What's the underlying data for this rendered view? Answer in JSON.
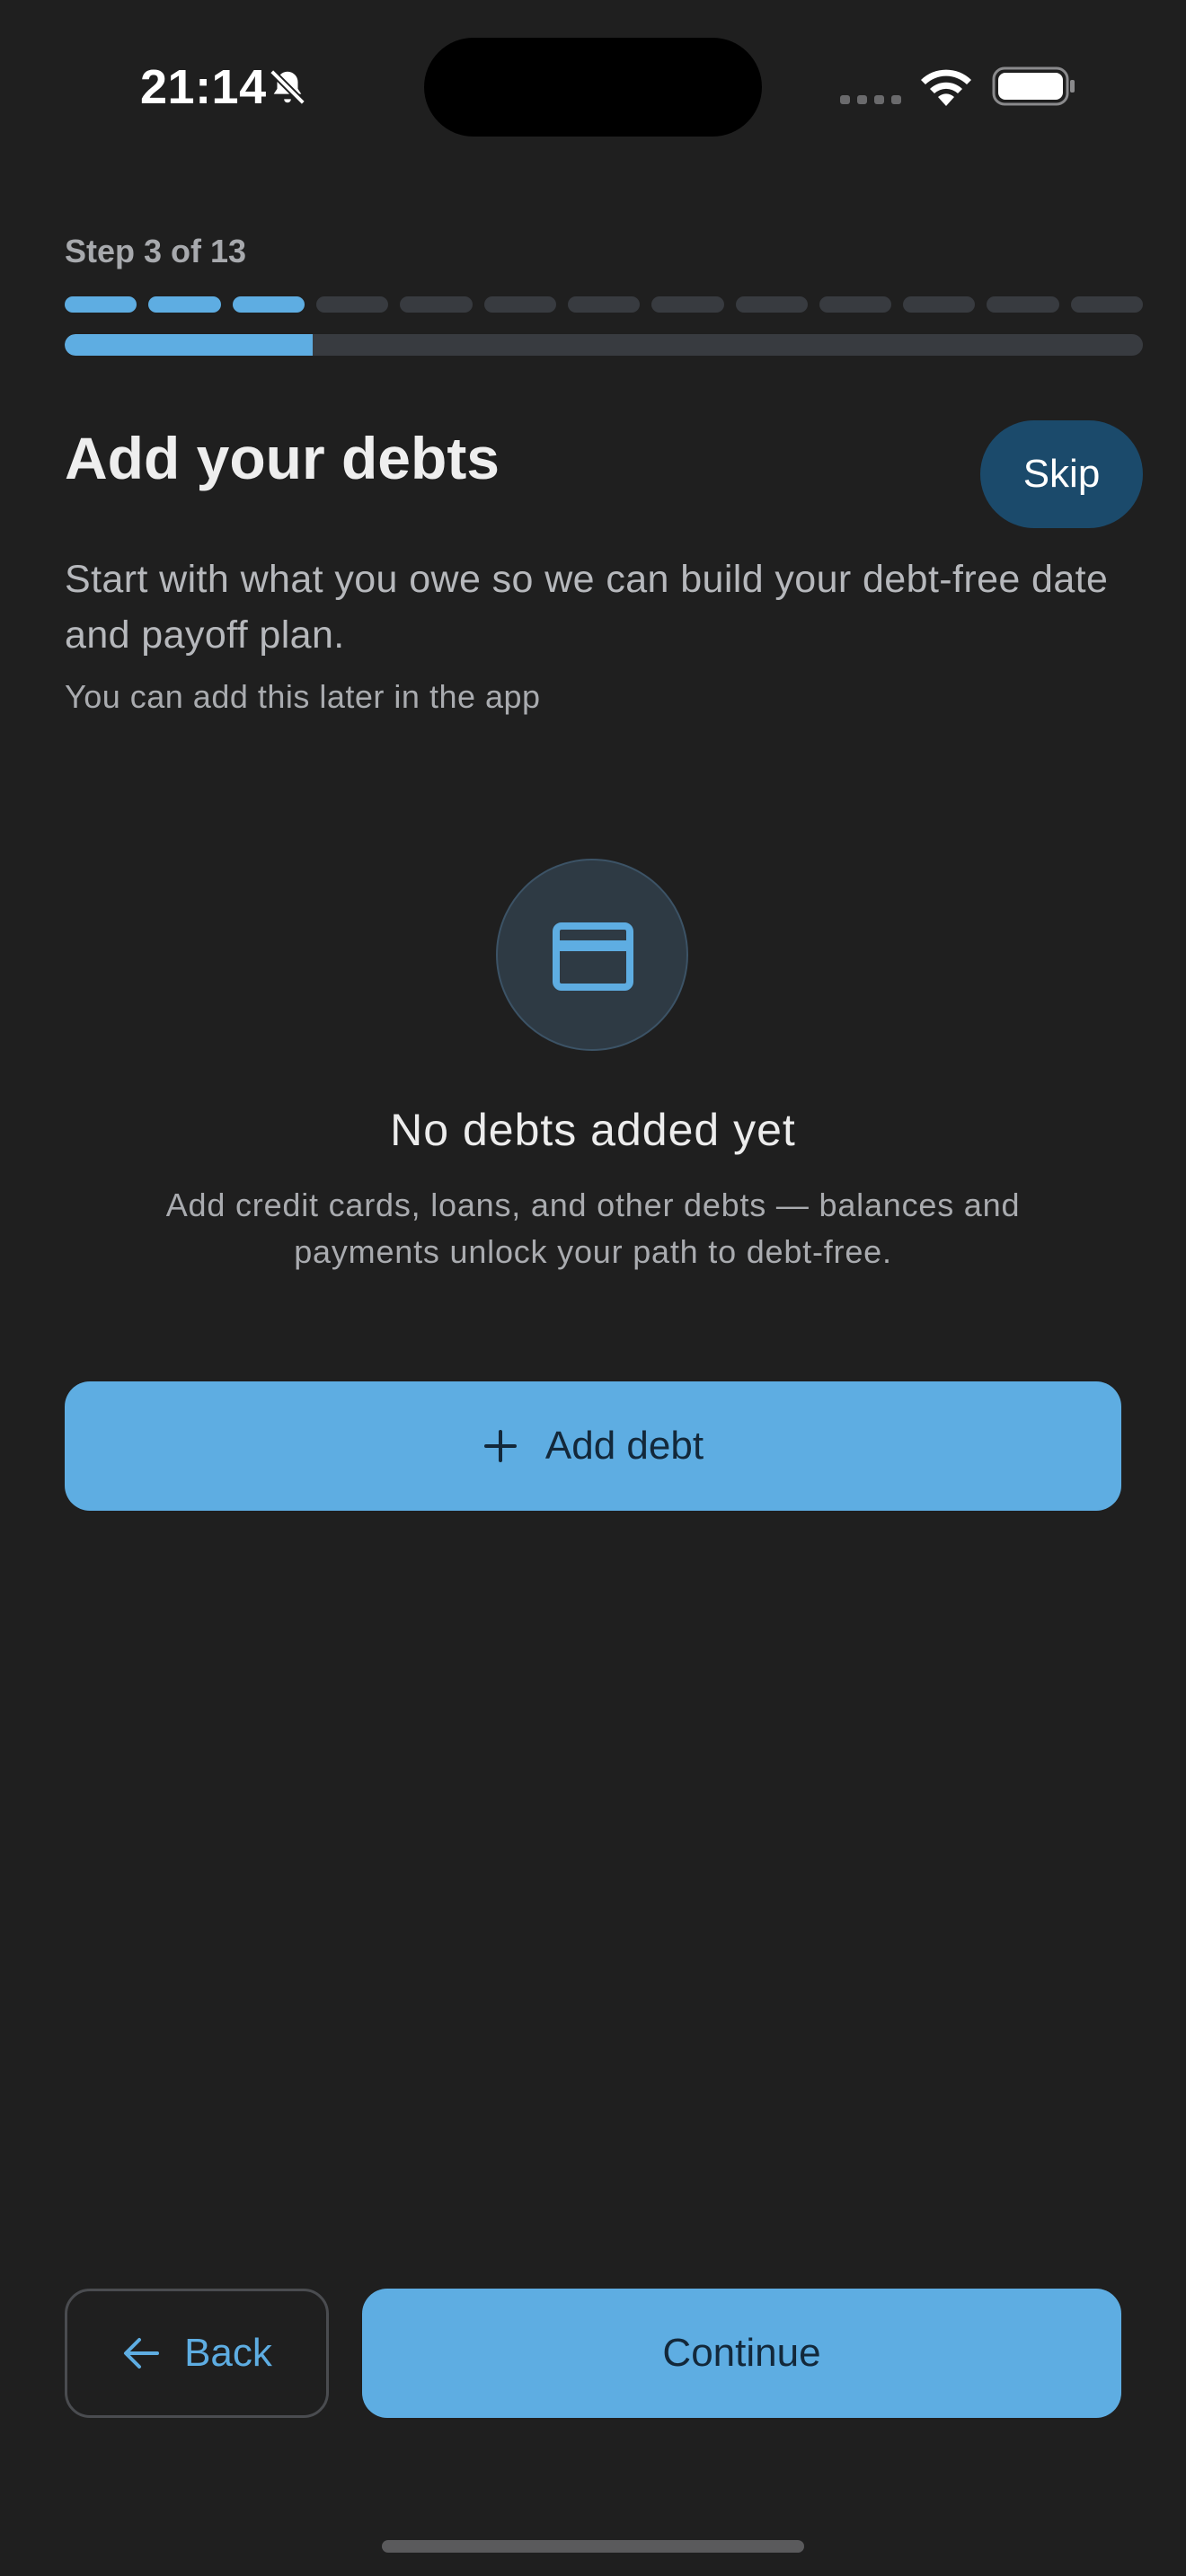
{
  "status_bar": {
    "time": "21:14",
    "icons": [
      "bell-slash-icon",
      "signal-icon",
      "wifi-icon",
      "battery-icon"
    ]
  },
  "progress": {
    "label": "Step 3 of 13",
    "current_step": 3,
    "total_steps": 13,
    "fill_fraction": 0.23
  },
  "header": {
    "title": "Add your debts",
    "skip_label": "Skip"
  },
  "intro": {
    "subtitle": "Start with what you owe so we can build your debt-free date and payoff plan.",
    "hint": "You can add this later in the app"
  },
  "empty_state": {
    "icon": "credit-card-icon",
    "title": "No debts added yet",
    "description": "Add credit cards, loans, and other debts — balances and payments unlock your path to debt-free."
  },
  "actions": {
    "add_debt_label": "Add debt",
    "back_label": "Back",
    "continue_label": "Continue"
  },
  "colors": {
    "background": "#1f1f1f",
    "accent": "#5eade2",
    "skip_background": "#1b4a6b",
    "track": "#383b40"
  }
}
